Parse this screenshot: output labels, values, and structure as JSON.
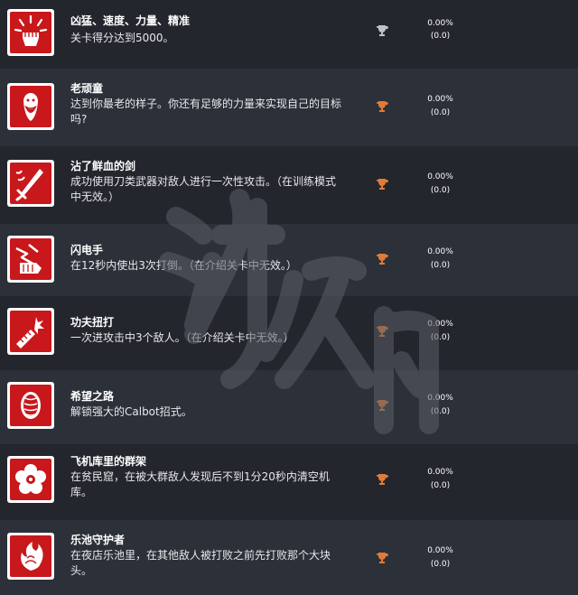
{
  "colors": {
    "row_dark": "#23262d",
    "row_light": "#2c3039",
    "badge_red": "#c8181c",
    "trophy_silver": "#bfc3c8",
    "trophy_bronze": "#e07b39"
  },
  "achievements": [
    {
      "title": "凶猛、速度、力量、精准",
      "desc": "关卡得分达到5000。",
      "trophy": "silver",
      "percent": "0.00%",
      "count": "(0.0)",
      "icon": "fist-burst-icon"
    },
    {
      "title": "老顽童",
      "desc": "达到你最老的样子。你还有足够的力量来实现自己的目标吗?",
      "trophy": "bronze",
      "percent": "0.00%",
      "count": "(0.0)",
      "icon": "old-master-icon"
    },
    {
      "title": "沾了鲜血的剑",
      "desc": "成功使用刀类武器对敌人进行一次性攻击。（在训练模式中无效。）",
      "trophy": "bronze",
      "percent": "0.00%",
      "count": "(0.0)",
      "icon": "bloody-sword-icon"
    },
    {
      "title": "闪电手",
      "desc": "在12秒内使出3次打倒。（在介绍关卡中无效。）",
      "trophy": "bronze",
      "percent": "0.00%",
      "count": "(0.0)",
      "icon": "lightning-hand-icon"
    },
    {
      "title": "功夫扭打",
      "desc": "一次进攻击中3个敌人。（在介绍关卡中无效。）",
      "trophy": "bronze",
      "percent": "0.00%",
      "count": "(0.0)",
      "icon": "kungfu-strike-icon"
    },
    {
      "title": "希望之路",
      "desc": "解锁强大的Calbot招式。",
      "trophy": "bronze",
      "percent": "0.00%",
      "count": "(0.0)",
      "icon": "tiger-emblem-icon"
    },
    {
      "title": "飞机库里的群架",
      "desc": "在贫民窟，在被大群敌人发现后不到1分20秒内清空机库。",
      "trophy": "bronze",
      "percent": "0.00%",
      "count": "(0.0)",
      "icon": "flower-icon"
    },
    {
      "title": "乐池守护者",
      "desc": "在夜店乐池里，在其他敌人被打败之前先打败那个大块头。",
      "trophy": "bronze",
      "percent": "0.00%",
      "count": "(0.0)",
      "icon": "dragon-fire-icon"
    }
  ]
}
